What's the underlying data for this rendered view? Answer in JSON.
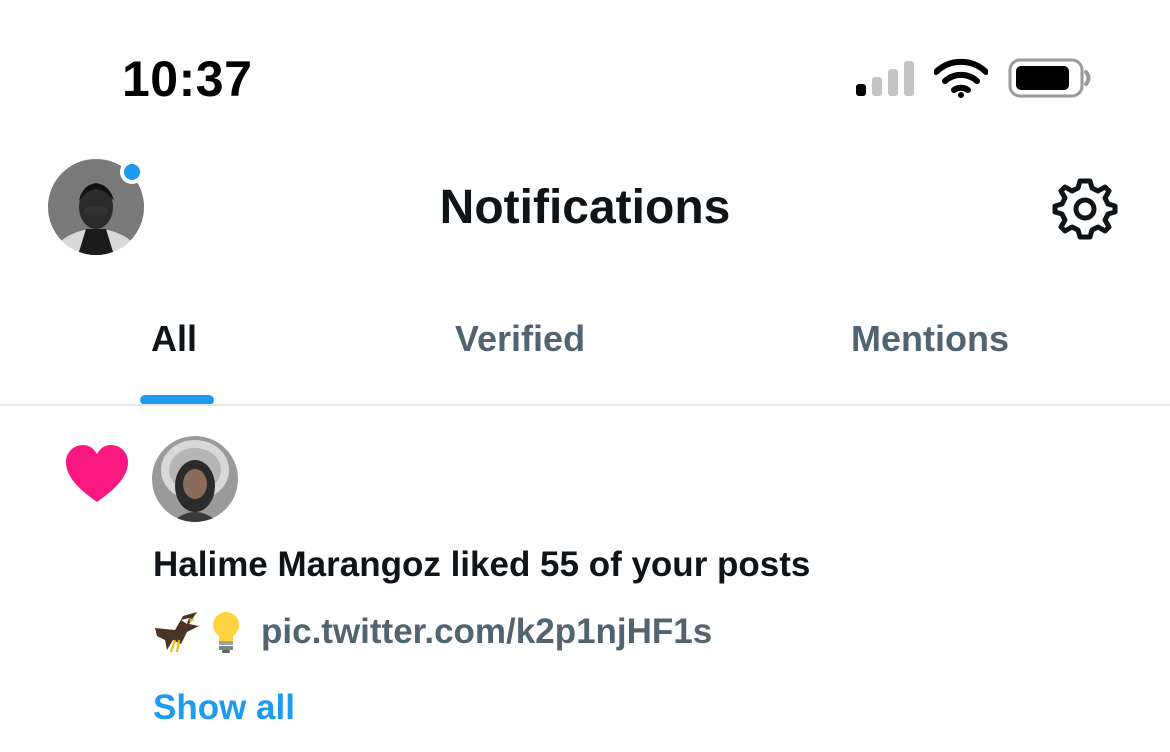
{
  "status_bar": {
    "time": "10:37"
  },
  "header": {
    "title": "Notifications"
  },
  "tabs": [
    {
      "label": "All",
      "active": true
    },
    {
      "label": "Verified",
      "active": false
    },
    {
      "label": "Mentions",
      "active": false
    }
  ],
  "notification": {
    "type_icon": "heart-icon",
    "text": "Halime Marangoz liked 55 of your posts",
    "post_emojis": [
      "eagle",
      "light-bulb"
    ],
    "post_link": "pic.twitter.com/k2p1njHF1s",
    "show_all_label": "Show all"
  },
  "colors": {
    "accent": "#1d9bf0",
    "like": "#f91880",
    "secondary_text": "#536471",
    "primary_text": "#0f1419"
  },
  "icons": [
    "signal-icon",
    "wifi-icon",
    "battery-icon",
    "settings-gear-icon",
    "heart-icon"
  ]
}
